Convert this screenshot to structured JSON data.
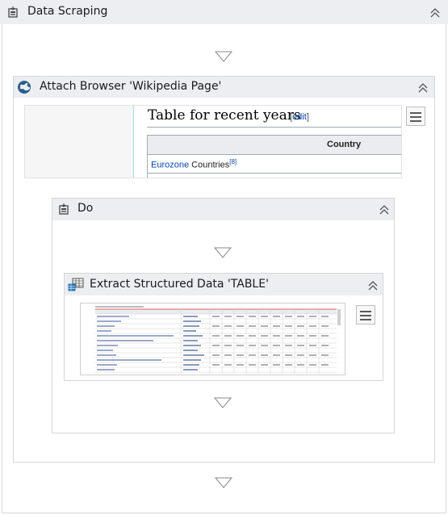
{
  "outer": {
    "title": "Data Scraping",
    "icon": "data-scraping-icon"
  },
  "attach": {
    "title": "Attach Browser 'Wikipedia Page'",
    "icon": "globe-icon"
  },
  "wiki": {
    "heading": "Table for recent years",
    "edit_open": "[",
    "edit_link": "edit",
    "edit_close": "]",
    "column_header": "Country",
    "row_link": "Eurozone",
    "row_text": " Countries",
    "row_ref": "[8]"
  },
  "do_block": {
    "title": "Do",
    "icon": "data-scraping-icon"
  },
  "extract": {
    "title": "Extract Structured Data 'TABLE'",
    "icon": "table-icon"
  },
  "colors": {
    "header_bg": "#eceef1",
    "border": "#d6d6d6",
    "link": "#0645ad",
    "table_header_bg": "#eaecf0"
  }
}
